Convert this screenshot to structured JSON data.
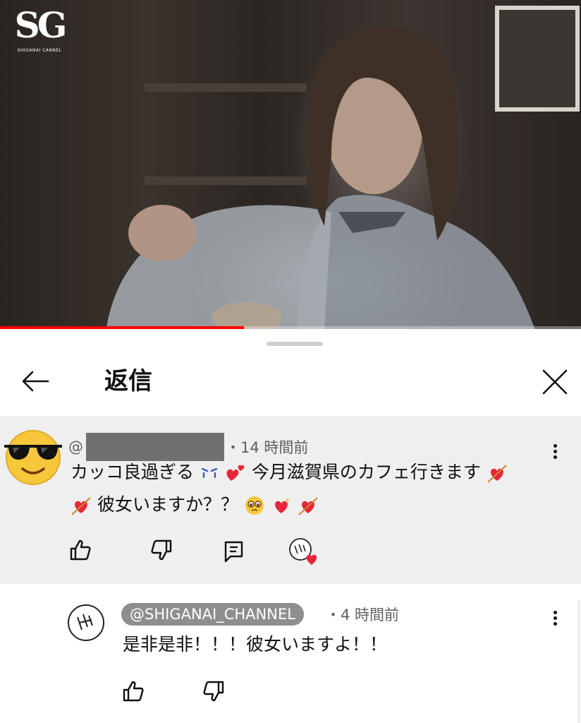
{
  "video": {
    "logo_text": "SG",
    "logo_subtitle": "SHIGANAI CANNEL",
    "progress": 0.42
  },
  "sheet": {
    "title": "返信",
    "back_icon": "arrow-left-icon",
    "close_icon": "close-icon"
  },
  "parent_comment": {
    "handle_prefix": "@",
    "handle_redacted": true,
    "time": "・14 時間前",
    "line1_a": "カッコ良過ぎる",
    "line1_b": "今月滋賀県のカフェ行きます",
    "line2": "彼女いますか？？",
    "avatar": "sunglasses-face-emoji",
    "actions": [
      "like-icon",
      "dislike-icon",
      "reply-icon",
      "creator-heart-icon"
    ]
  },
  "reply_comment": {
    "handle": "@SHIGANAI_CHANNEL",
    "time": "・4 時間前",
    "text": "是非是非！！！彼女いますよ！！",
    "actions": [
      "like-icon",
      "dislike-icon"
    ]
  },
  "colors": {
    "progress": "#ff0000",
    "heart": "#e8263a",
    "chip": "#8e8e8e"
  }
}
